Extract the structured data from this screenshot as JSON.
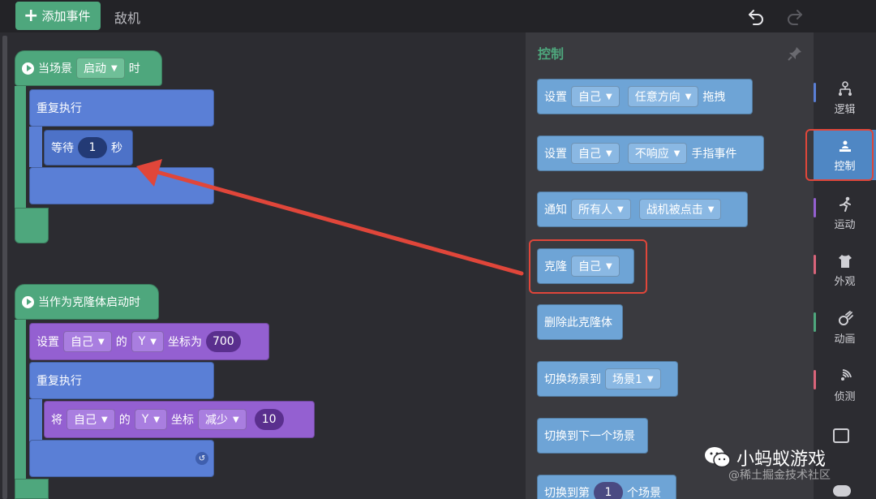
{
  "toolbar": {
    "add_event_label": "添加事件",
    "sprite_tab": "敌机"
  },
  "workspace": {
    "script1": {
      "hat_prefix": "当场景",
      "hat_dropdown": "启动",
      "hat_suffix": "时",
      "repeat_label": "重复执行",
      "wait_label": "等待",
      "wait_value": "1",
      "wait_unit": "秒"
    },
    "script2": {
      "hat_label": "当作为克隆体启动时",
      "set_label": "设置",
      "set_target": "自己",
      "set_of": "的",
      "set_axis": "Y",
      "set_coord_label": "坐标为",
      "set_value": "700",
      "repeat_label": "重复执行",
      "change_label": "将",
      "change_target": "自己",
      "change_of": "的",
      "change_axis": "Y",
      "change_coord_label": "坐标",
      "change_op": "减少",
      "change_value": "10"
    }
  },
  "palette": {
    "title": "控制",
    "blocks": [
      {
        "p1": "设置",
        "d1": "自己",
        "d2": "任意方向",
        "p2": "拖拽"
      },
      {
        "p1": "设置",
        "d1": "自己",
        "d2": "不响应",
        "p2": "手指事件"
      },
      {
        "p1": "通知",
        "d1": "所有人",
        "d2": "战机被点击"
      },
      {
        "p1": "克隆",
        "d1": "自己"
      },
      {
        "p1": "删除此克隆体"
      },
      {
        "p1": "切换场景到",
        "d1": "场景1"
      },
      {
        "p1": "切换到下一个场景"
      },
      {
        "p1": "切换到第",
        "n1": "1",
        "p2": "个场景"
      }
    ]
  },
  "sidebar": {
    "categories": [
      {
        "label": "逻辑",
        "icon": "logic-icon",
        "color": "#5a7fd6"
      },
      {
        "label": "控制",
        "icon": "control-icon",
        "color": "#4f87c4",
        "active": true
      },
      {
        "label": "运动",
        "icon": "motion-icon",
        "color": "#9460d1"
      },
      {
        "label": "外观",
        "icon": "appearance-icon",
        "color": "#d9647a"
      },
      {
        "label": "动画",
        "icon": "animation-icon",
        "color": "#4ea77d"
      },
      {
        "label": "侦测",
        "icon": "sensing-icon",
        "color": "#d9647a"
      }
    ]
  },
  "watermark": {
    "main": "小蚂蚁游戏",
    "sub": "@稀土掘金技术社区"
  },
  "colors": {
    "event_green": "#4ea77d",
    "control_blue": "#5a7fd6",
    "motion_purple": "#9460d1",
    "palette_block": "#6ea4d6",
    "highlight_red": "#e0463a"
  }
}
